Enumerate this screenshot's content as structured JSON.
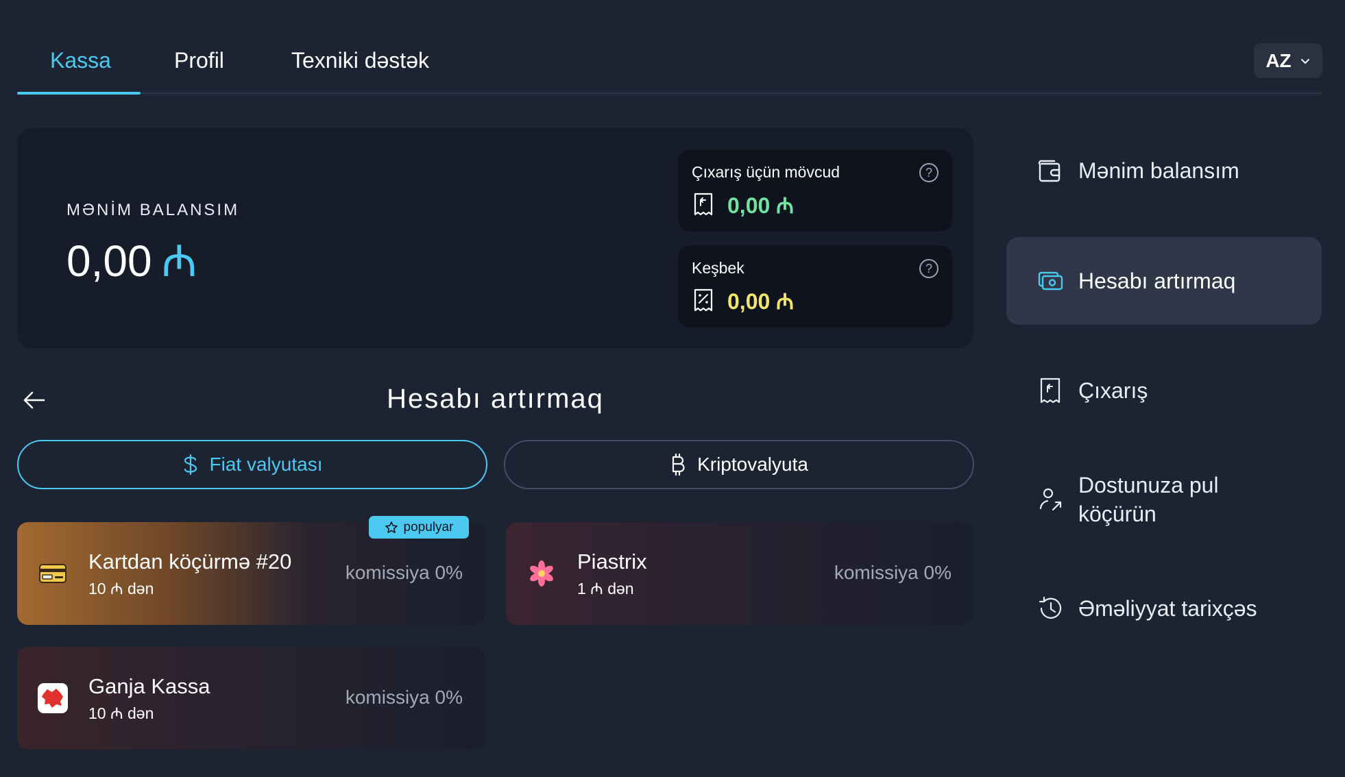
{
  "nav": {
    "tabs": [
      {
        "label": "Kassa",
        "active": true
      },
      {
        "label": "Profil",
        "active": false
      },
      {
        "label": "Texniki dəstək",
        "active": false
      }
    ],
    "language": "AZ"
  },
  "balance": {
    "label": "MƏNİM BALANSIM",
    "amount": "0,00",
    "currency_symbol": "₼",
    "withdrawable": {
      "label": "Çıxarış üçün mövcud",
      "value": "0,00 ₼"
    },
    "cashback": {
      "label": "Keşbek",
      "value": "0,00 ₼"
    }
  },
  "sidebar": {
    "items": [
      {
        "label": "Mənim balansım",
        "icon": "wallet-icon",
        "active": false
      },
      {
        "label": "Hesabı artırmaq",
        "icon": "cash-icon",
        "active": true
      },
      {
        "label": "Çıxarış",
        "icon": "receipt-icon",
        "active": false
      },
      {
        "label": "Dostunuza pul köçürün",
        "icon": "user-transfer-icon",
        "active": false
      },
      {
        "label": "Əməliyyat tarixçəs",
        "icon": "history-icon",
        "active": false
      }
    ]
  },
  "section": {
    "title": "Hesabı artırmaq"
  },
  "currency_toggle": {
    "fiat_label": "Fiat valyutası",
    "crypto_label": "Kriptovalyuta",
    "selected": "fiat"
  },
  "payment_methods": [
    {
      "name": "Kartdan köçürmə #20",
      "min": "10 ₼ dən",
      "fee": "komissiya 0%",
      "badge": "populyar",
      "icon": "card-icon"
    },
    {
      "name": "Piastrix",
      "min": "1 ₼ dən",
      "fee": "komissiya 0%",
      "icon": "piastrix-logo-icon"
    },
    {
      "name": "Ganja Kassa",
      "min": "10 ₼ dən",
      "fee": "komissiya 0%",
      "icon": "ganja-kassa-logo-icon"
    }
  ],
  "colors": {
    "background": "#1c2333",
    "accent": "#4cc9f0",
    "withdraw_value": "#6fe3a0",
    "cashback_value": "#f2e56a"
  }
}
